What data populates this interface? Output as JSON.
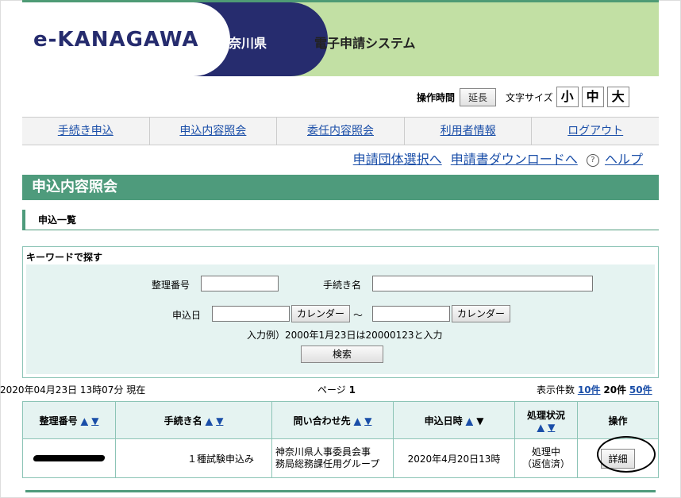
{
  "header": {
    "logo": "e-KANAGAWA",
    "prefecture": "神奈川県",
    "system_name": "電子申請システム"
  },
  "tools": {
    "session_label": "操作時間",
    "extend_label": "延長",
    "font_size_label": "文字サイズ",
    "size_small": "小",
    "size_medium": "中",
    "size_large": "大"
  },
  "nav": {
    "items": [
      "手続き申込",
      "申込内容照会",
      "委任内容照会",
      "利用者情報",
      "ログアウト"
    ]
  },
  "sublinks": {
    "group_select": "申請団体選択へ",
    "download": "申請書ダウンロードへ",
    "help": "ヘルプ"
  },
  "page": {
    "title": "申込内容照会",
    "subtitle": "申込一覧"
  },
  "search": {
    "heading": "キーワードで探す",
    "ref_no_label": "整理番号",
    "ref_no_value": "",
    "procedure_label": "手続き名",
    "procedure_value": "",
    "date_label": "申込日",
    "calendar_label": "カレンダー",
    "tilde": "～",
    "example": "入力例）2000年1月23日は20000123と入力",
    "search_button": "検索"
  },
  "status_bar": {
    "timestamp": "2020年04月23日 13時07分 現在",
    "page_label": "ページ",
    "page_number": "1",
    "count_label": "表示件数",
    "opt_10": "10件",
    "opt_20": "20件",
    "opt_50": "50件"
  },
  "table": {
    "headers": {
      "ref_no": "整理番号",
      "procedure": "手続き名",
      "contact": "問い合わせ先",
      "date": "申込日時",
      "status": "処理状況",
      "action": "操作"
    },
    "rows": [
      {
        "procedure": "１種試験申込み",
        "contact_line1": "神奈川県人事委員会事",
        "contact_line2": "務局総務課任用グループ",
        "date": "2020年4月20日13時",
        "status_line1": "処理中",
        "status_line2": "（返信済）",
        "action": "詳細"
      }
    ]
  },
  "colors": {
    "accent_green": "#4e9b7c",
    "banner_green": "#c2e0a4",
    "navy": "#262c6e",
    "link_blue": "#1a4ea8"
  }
}
